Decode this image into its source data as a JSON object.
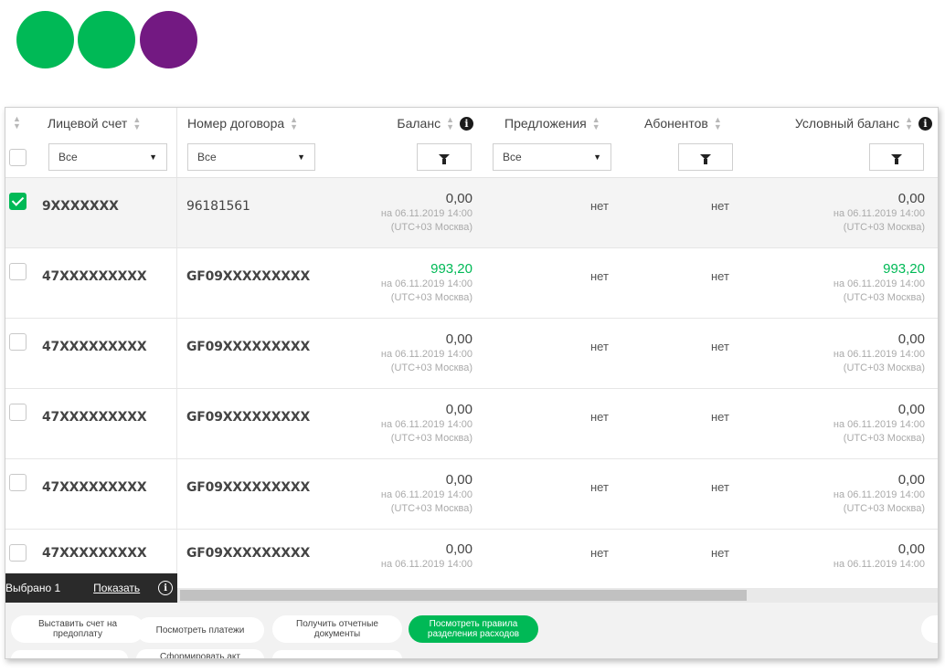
{
  "columns": {
    "account": "Лицевой счет",
    "contract": "Номер договора",
    "balance": "Баланс",
    "offers": "Предложения",
    "subscribers": "Абонентов",
    "conditional_balance": "Условный баланс"
  },
  "filters": {
    "account": "Все",
    "contract": "Все",
    "offers": "Все"
  },
  "rows": [
    {
      "account": "9XXXXXXX",
      "contract": "96181561",
      "balance": "0,00",
      "balance_date": "на 06.11.2019 14:00",
      "balance_tz": "(UTC+03 Москва)",
      "offers": "нет",
      "subscribers": "нет",
      "cond_balance": "0,00",
      "cond_date": "на 06.11.2019 14:00",
      "cond_tz": "(UTC+03 Москва)",
      "selected": true
    },
    {
      "account": "47XXXXXXXXX",
      "contract": "GF09XXXXXXXXX",
      "balance": "993,20",
      "balance_date": "на 06.11.2019 14:00",
      "balance_tz": "(UTC+03 Москва)",
      "offers": "нет",
      "subscribers": "нет",
      "cond_balance": "993,20",
      "cond_date": "на 06.11.2019 14:00",
      "cond_tz": "(UTC+03 Москва)",
      "selected": false
    },
    {
      "account": "47XXXXXXXXX",
      "contract": "GF09XXXXXXXXX",
      "balance": "0,00",
      "balance_date": "на 06.11.2019 14:00",
      "balance_tz": "(UTC+03 Москва)",
      "offers": "нет",
      "subscribers": "нет",
      "cond_balance": "0,00",
      "cond_date": "на 06.11.2019 14:00",
      "cond_tz": "(UTC+03 Москва)",
      "selected": false
    },
    {
      "account": "47XXXXXXXXX",
      "contract": "GF09XXXXXXXXX",
      "balance": "0,00",
      "balance_date": "на 06.11.2019 14:00",
      "balance_tz": "(UTC+03 Москва)",
      "offers": "нет",
      "subscribers": "нет",
      "cond_balance": "0,00",
      "cond_date": "на 06.11.2019 14:00",
      "cond_tz": "(UTC+03 Москва)",
      "selected": false
    },
    {
      "account": "47XXXXXXXXX",
      "contract": "GF09XXXXXXXXX",
      "balance": "0,00",
      "balance_date": "на 06.11.2019 14:00",
      "balance_tz": "(UTC+03 Москва)",
      "offers": "нет",
      "subscribers": "нет",
      "cond_balance": "0,00",
      "cond_date": "на 06.11.2019 14:00",
      "cond_tz": "(UTC+03 Москва)",
      "selected": false
    },
    {
      "account": "47XXXXXXXXX",
      "contract": "GF09XXXXXXXXX",
      "balance": "0,00",
      "balance_date": "на 06.11.2019 14:00",
      "balance_tz": "",
      "offers": "нет",
      "subscribers": "нет",
      "cond_balance": "0,00",
      "cond_date": "на 06.11.2019 14:00",
      "cond_tz": "",
      "selected": false
    }
  ],
  "selection_bar": {
    "count_label": "Выбрано 1",
    "show_label": "Показать",
    "info_glyph": "i"
  },
  "actions": {
    "invoice": "Выставить счет на предоплату",
    "payments": "Посмотреть платежи",
    "reports": "Получить отчетные документы",
    "rules": "Посмотреть правила разделения расходов",
    "act": "Сформировать акт"
  },
  "icons": {
    "sort": "sort-icon",
    "info": "info-icon",
    "filter": "filter-icon",
    "dropdown": "chevron-down-icon"
  },
  "colors": {
    "brand_green": "#00b956",
    "brand_purple": "#731982",
    "selection_bar": "#2a2a2a"
  }
}
